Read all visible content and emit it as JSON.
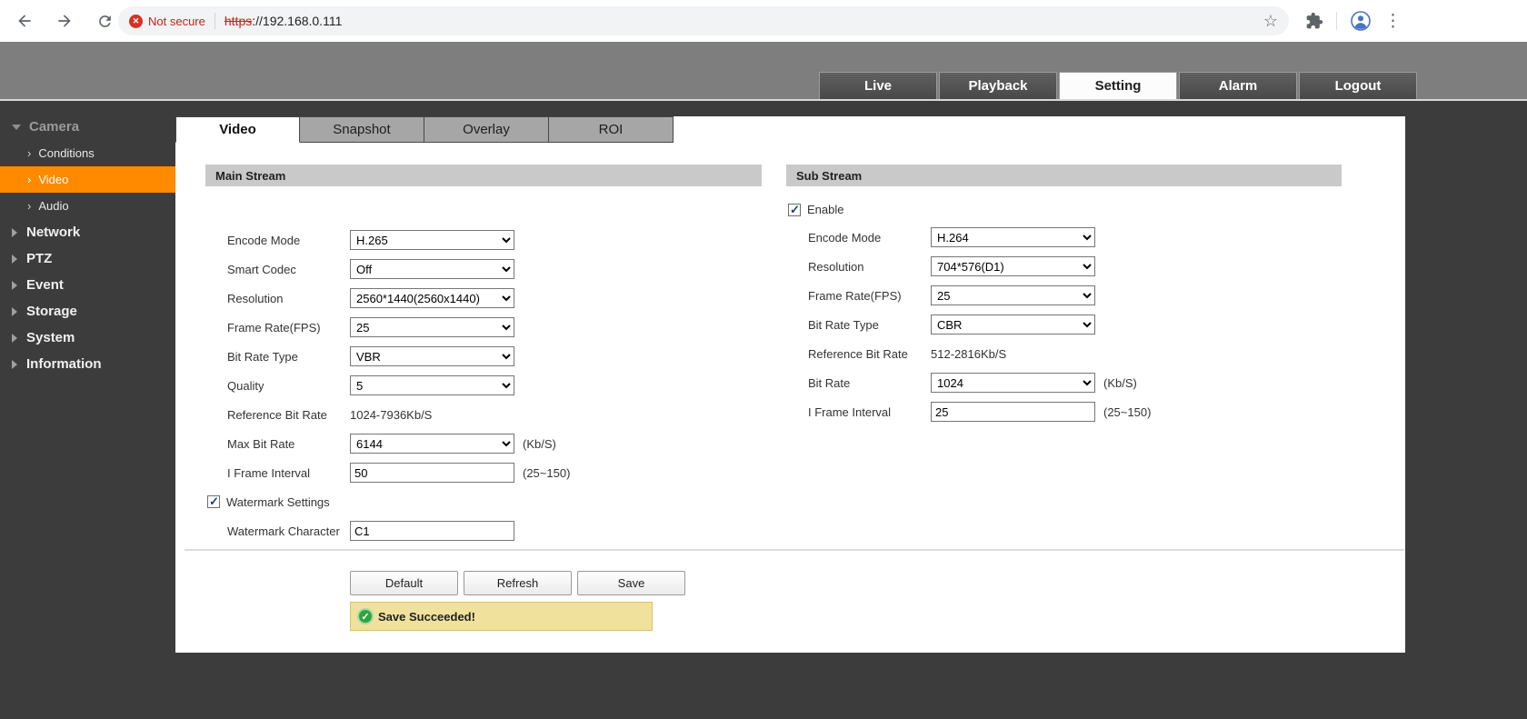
{
  "browser": {
    "security_label": "Not secure",
    "url_scheme": "https",
    "url_rest": "://192.168.0.111"
  },
  "header": {
    "tabs": [
      "Live",
      "Playback",
      "Setting",
      "Alarm",
      "Logout"
    ]
  },
  "sidebar": {
    "camera_label": "Camera",
    "camera_children": [
      "Conditions",
      "Video",
      "Audio"
    ],
    "items": [
      "Network",
      "PTZ",
      "Event",
      "Storage",
      "System",
      "Information"
    ]
  },
  "content": {
    "tabs": [
      "Video",
      "Snapshot",
      "Overlay",
      "ROI"
    ]
  },
  "main_stream": {
    "title": "Main Stream",
    "encode_mode": {
      "label": "Encode Mode",
      "value": "H.265"
    },
    "smart_codec": {
      "label": "Smart Codec",
      "value": "Off"
    },
    "resolution": {
      "label": "Resolution",
      "value": "2560*1440(2560x1440)"
    },
    "frame_rate": {
      "label": "Frame Rate(FPS)",
      "value": "25"
    },
    "bit_rate_type": {
      "label": "Bit Rate Type",
      "value": "VBR"
    },
    "quality": {
      "label": "Quality",
      "value": "5"
    },
    "reference_bit_rate": {
      "label": "Reference Bit Rate",
      "value": "1024-7936Kb/S"
    },
    "max_bit_rate": {
      "label": "Max Bit Rate",
      "value": "6144",
      "suffix": "(Kb/S)"
    },
    "i_frame_interval": {
      "label": "I Frame Interval",
      "value": "50",
      "suffix": "(25~150)"
    },
    "watermark_settings": {
      "label": "Watermark Settings",
      "checked": true
    },
    "watermark_character": {
      "label": "Watermark Character",
      "value": "C1"
    }
  },
  "sub_stream": {
    "title": "Sub Stream",
    "enable": {
      "label": "Enable",
      "checked": true
    },
    "encode_mode": {
      "label": "Encode Mode",
      "value": "H.264"
    },
    "resolution": {
      "label": "Resolution",
      "value": "704*576(D1)"
    },
    "frame_rate": {
      "label": "Frame Rate(FPS)",
      "value": "25"
    },
    "bit_rate_type": {
      "label": "Bit Rate Type",
      "value": "CBR"
    },
    "reference_bit_rate": {
      "label": "Reference Bit Rate",
      "value": "512-2816Kb/S"
    },
    "bit_rate": {
      "label": "Bit Rate",
      "value": "1024",
      "suffix": "(Kb/S)"
    },
    "i_frame_interval": {
      "label": "I Frame Interval",
      "value": "25",
      "suffix": "(25~150)"
    }
  },
  "actions": {
    "default": "Default",
    "refresh": "Refresh",
    "save": "Save"
  },
  "toast": {
    "message": "Save Succeeded!"
  }
}
